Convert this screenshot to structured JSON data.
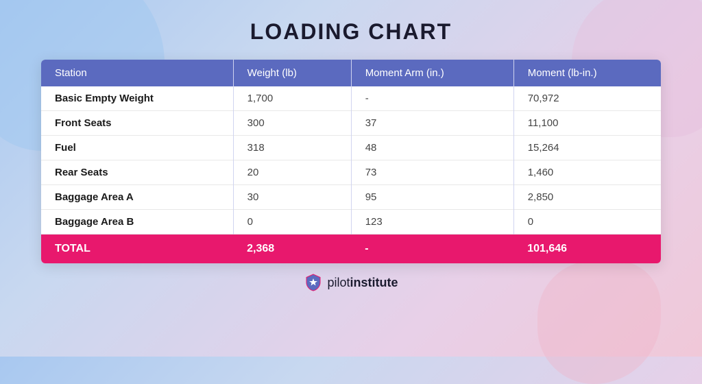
{
  "page": {
    "title": "LOADING CHART"
  },
  "table": {
    "headers": [
      "Station",
      "Weight (lb)",
      "Moment Arm (in.)",
      "Moment (lb-in.)"
    ],
    "rows": [
      {
        "station": "Basic Empty Weight",
        "weight": "1,700",
        "moment_arm": "-",
        "moment": "70,972"
      },
      {
        "station": "Front Seats",
        "weight": "300",
        "moment_arm": "37",
        "moment": "11,100"
      },
      {
        "station": "Fuel",
        "weight": "318",
        "moment_arm": "48",
        "moment": "15,264"
      },
      {
        "station": "Rear Seats",
        "weight": "20",
        "moment_arm": "73",
        "moment": "1,460"
      },
      {
        "station": "Baggage Area A",
        "weight": "30",
        "moment_arm": "95",
        "moment": "2,850"
      },
      {
        "station": "Baggage Area B",
        "weight": "0",
        "moment_arm": "123",
        "moment": "0"
      }
    ],
    "total": {
      "label": "TOTAL",
      "weight": "2,368",
      "moment_arm": "-",
      "moment": "101,646"
    }
  },
  "footer": {
    "brand_pilot": "pilot",
    "brand_institute": "institute",
    "logo_alt": "pilot institute shield logo"
  },
  "colors": {
    "header_bg": "#5b6abf",
    "total_bg": "#e8186d",
    "title_color": "#1a1a2e"
  }
}
